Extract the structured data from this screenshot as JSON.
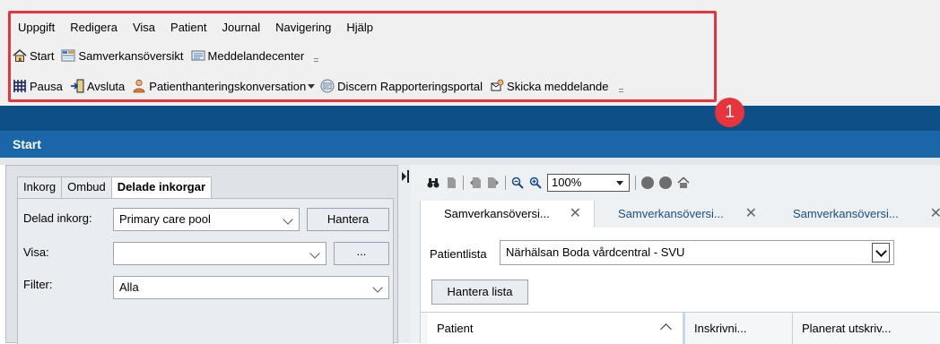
{
  "menu": [
    "Uppgift",
    "Redigera",
    "Visa",
    "Patient",
    "Journal",
    "Navigering",
    "Hjälp"
  ],
  "toolbar1": [
    {
      "label": "Start",
      "icon": "home-icon"
    },
    {
      "label": "Samverkansöversikt",
      "icon": "overview-grid-icon"
    },
    {
      "label": "Meddelandecenter",
      "icon": "message-center-icon"
    }
  ],
  "toolbar2": [
    {
      "label": "Pausa",
      "icon": "pause-grid-icon"
    },
    {
      "label": "Avsluta",
      "icon": "exit-door-icon"
    },
    {
      "label": "Patienthanteringskonversation",
      "icon": "person-icon"
    },
    {
      "label": "Discern Rapporteringsportal",
      "icon": "report-portal-icon"
    },
    {
      "label": "Skicka meddelande",
      "icon": "send-message-icon"
    }
  ],
  "badge": "1",
  "title": "Start",
  "left": {
    "tabs": [
      "Inkorg",
      "Ombud",
      "Delade inkorgar"
    ],
    "active_tab": "Delade inkorgar",
    "delad_label": "Delad inkorg:",
    "delad_value": "Primary care pool",
    "hantera_btn": "Hantera",
    "visa_label": "Visa:",
    "visa_value": "",
    "ellipsis_btn": "...",
    "filter_label": "Filter:",
    "filter_value": "Alla"
  },
  "right": {
    "zoom": "100%",
    "tabs": [
      "Samverkansöversi...",
      "Samverkansöversi...",
      "Samverkansöversi..."
    ],
    "patientlista_label": "Patientlista",
    "patientlista_value": "Närhälsan Boda vårdcentral - SVU",
    "hantera_lista": "Hantera lista",
    "columns": [
      "Patient",
      "Inskrivni...",
      "Planerat utskriv..."
    ]
  },
  "colors": {
    "accent_red": "#e8343c",
    "title_blue": "#1a66a8",
    "band_dark": "#0d4f86"
  }
}
